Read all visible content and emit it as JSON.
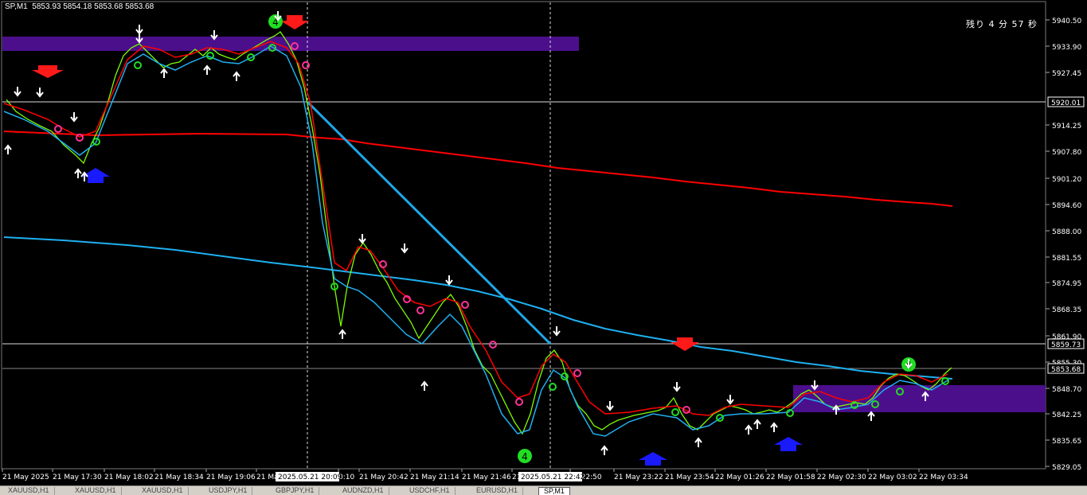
{
  "header": {
    "symbol": "SP,M1",
    "ohlc": "5853.93 5854.18 5853.68 5853.68"
  },
  "timer": "残り 4 分 57 秒",
  "price_axis": {
    "labels": [
      "5940.50",
      "5933.90",
      "5927.45",
      "5914.25",
      "5907.80",
      "5901.20",
      "5894.60",
      "5888.00",
      "5881.55",
      "5874.95",
      "5868.35",
      "5861.90",
      "5855.30",
      "5848.70",
      "5842.25",
      "5835.65",
      "5829.05"
    ],
    "markers": [
      {
        "value": "5920.01",
        "color": "#ffffff"
      },
      {
        "value": "5859.73",
        "color": "#ffffff"
      },
      {
        "value": "5853.68",
        "color": "#ffffff"
      }
    ]
  },
  "time_axis": {
    "labels": [
      "21 May 2025",
      "21 May 17:30",
      "21 May 18:02",
      "21 May 18:34",
      "21 May 19:06",
      "21 Ma",
      "0:10",
      "21 May 20:42",
      "21 May 21:14",
      "21 May 21:46",
      "21",
      "ay 22:50",
      "21 May 23:22",
      "21 May 23:54",
      "22 May 01:26",
      "22 May 01:58",
      "22 May 02:30",
      "22 May 03:02",
      "22 May 03:34"
    ],
    "cursor_labels": [
      "2025.05.21 20:09",
      "2025.05.21 22:42"
    ]
  },
  "tabs": [
    {
      "label": "XAUUSD,H1",
      "active": false
    },
    {
      "label": "XAUUSD,H1",
      "active": false
    },
    {
      "label": "XAUUSD,H1",
      "active": false
    },
    {
      "label": "USDJPY,H1",
      "active": false
    },
    {
      "label": "GBPJPY,H1",
      "active": false
    },
    {
      "label": "AUDNZD,H1",
      "active": false
    },
    {
      "label": "USDCHF,H1",
      "active": false
    },
    {
      "label": "EURUSD,H1",
      "active": false
    },
    {
      "label": "SP,M1",
      "active": true
    }
  ],
  "signals": {
    "circle_labels": [
      "4",
      "4",
      "4"
    ]
  },
  "colors": {
    "background": "#000000",
    "price_bars": "#7cfc00",
    "red_line": "#ff0000",
    "blue_line": "#1fb0f0",
    "purple_zone": "#4b0f8c",
    "trend_line": "#1fa7e8"
  }
}
